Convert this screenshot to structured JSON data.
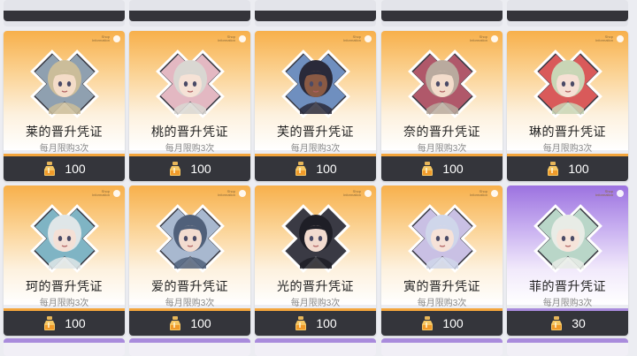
{
  "shop": {
    "items": [
      {
        "name": "莱的晋升凭证",
        "limit": "每月限购3次",
        "price": "100",
        "tier": "gold",
        "hair": "#cbbd9a",
        "skin": "#f4dcc8",
        "bg": "#8fa0b0"
      },
      {
        "name": "桃的晋升凭证",
        "limit": "每月限购3次",
        "price": "100",
        "tier": "gold",
        "hair": "#d9d7d2",
        "skin": "#f6e2d6",
        "bg": "#e3b8c2"
      },
      {
        "name": "芙的晋升凭证",
        "limit": "每月限购3次",
        "price": "100",
        "tier": "gold",
        "hair": "#2a2a3a",
        "skin": "#8a5a44",
        "bg": "#6f8fbf"
      },
      {
        "name": "奈的晋升凭证",
        "limit": "每月限购3次",
        "price": "100",
        "tier": "gold",
        "hair": "#b9aa9e",
        "skin": "#f3dccb",
        "bg": "#b0586a"
      },
      {
        "name": "琳的晋升凭证",
        "limit": "每月限购3次",
        "price": "100",
        "tier": "gold",
        "hair": "#c9d6b6",
        "skin": "#f6e0d4",
        "bg": "#d95a5a"
      },
      {
        "name": "珂的晋升凭证",
        "limit": "每月限购3次",
        "price": "100",
        "tier": "gold",
        "hair": "#dfe6e8",
        "skin": "#f4e0d6",
        "bg": "#7fb4c4"
      },
      {
        "name": "爱的晋升凭证",
        "limit": "每月限购3次",
        "price": "100",
        "tier": "gold",
        "hair": "#50607a",
        "skin": "#f3dcd0",
        "bg": "#a8b8cf"
      },
      {
        "name": "光的晋升凭证",
        "limit": "每月限购3次",
        "price": "100",
        "tier": "gold",
        "hair": "#1e1e26",
        "skin": "#f2dbcf",
        "bg": "#3a3a44"
      },
      {
        "name": "寅的晋升凭证",
        "limit": "每月限购3次",
        "price": "100",
        "tier": "gold",
        "hair": "#cfd6ea",
        "skin": "#f6e2d8",
        "bg": "#c9c0e4"
      },
      {
        "name": "菲的晋升凭证",
        "limit": "每月限购3次",
        "price": "30",
        "tier": "purple",
        "hair": "#e8ece6",
        "skin": "#f6e4da",
        "bg": "#b9d6c8"
      }
    ],
    "tag_text": "Shop\nInformation"
  }
}
